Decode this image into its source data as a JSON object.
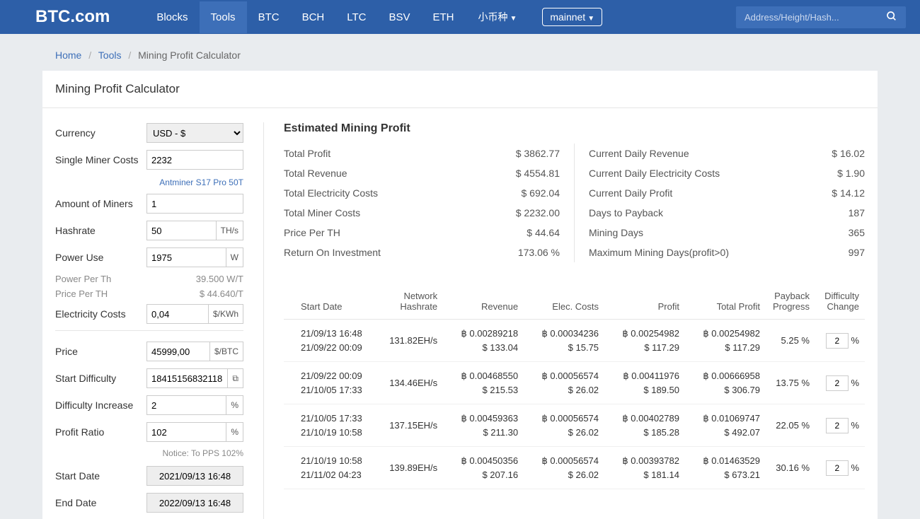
{
  "brand": "BTC.com",
  "nav": {
    "blocks": "Blocks",
    "tools": "Tools",
    "btc": "BTC",
    "bch": "BCH",
    "ltc": "LTC",
    "bsv": "BSV",
    "eth": "ETH",
    "small": "小币种",
    "net": "mainnet"
  },
  "search_placeholder": "Address/Height/Hash...",
  "breadcrumb": {
    "home": "Home",
    "tools": "Tools",
    "current": "Mining Profit Calculator"
  },
  "page_title": "Mining Profit Calculator",
  "form": {
    "currency_label": "Currency",
    "currency_value": "USD - $",
    "single_miner_label": "Single Miner Costs",
    "single_miner_value": "2232",
    "miner_model": "Antminer S17 Pro 50T",
    "amount_label": "Amount of Miners",
    "amount_value": "1",
    "hashrate_label": "Hashrate",
    "hashrate_value": "50",
    "hashrate_unit": "TH/s",
    "power_label": "Power Use",
    "power_value": "1975",
    "power_unit": "W",
    "power_per_th_label": "Power Per Th",
    "power_per_th_value": "39.500 W/T",
    "price_per_th_label": "Price Per TH",
    "price_per_th_value": "$ 44.640/T",
    "elec_label": "Electricity Costs",
    "elec_value": "0,04",
    "elec_unit": "$/KWh",
    "price_label": "Price",
    "price_value": "45999,00",
    "price_unit": "$/BTC",
    "start_diff_label": "Start Difficulty",
    "start_diff_value": "18415156832118",
    "diff_inc_label": "Difficulty Increase",
    "diff_inc_value": "2",
    "pct_unit": "%",
    "profit_ratio_label": "Profit Ratio",
    "profit_ratio_value": "102",
    "notice": "Notice: To PPS 102%",
    "start_date_label": "Start Date",
    "start_date_value": "2021/09/13 16:48",
    "end_date_label": "End Date",
    "end_date_value": "2022/09/13 16:48"
  },
  "estimated_title": "Estimated Mining Profit",
  "stats_left": {
    "total_profit_l": "Total Profit",
    "total_profit_v": "$ 3862.77",
    "total_revenue_l": "Total Revenue",
    "total_revenue_v": "$ 4554.81",
    "total_elec_l": "Total Electricity Costs",
    "total_elec_v": "$ 692.04",
    "total_miner_l": "Total Miner Costs",
    "total_miner_v": "$ 2232.00",
    "price_th_l": "Price Per TH",
    "price_th_v": "$ 44.64",
    "roi_l": "Return On Investment",
    "roi_v": "173.06 %"
  },
  "stats_right": {
    "daily_rev_l": "Current Daily Revenue",
    "daily_rev_v": "$ 16.02",
    "daily_elec_l": "Current Daily Electricity Costs",
    "daily_elec_v": "$ 1.90",
    "daily_profit_l": "Current Daily Profit",
    "daily_profit_v": "$ 14.12",
    "payback_l": "Days to Payback",
    "payback_v": "187",
    "mining_days_l": "Mining Days",
    "mining_days_v": "365",
    "max_days_l": "Maximum Mining Days(profit>0)",
    "max_days_v": "997"
  },
  "table_headers": {
    "start": "Start Date",
    "hashrate": "Network Hashrate",
    "revenue": "Revenue",
    "elec": "Elec. Costs",
    "profit": "Profit",
    "total_profit": "Total Profit",
    "payback": "Payback Progress",
    "diff": "Difficulty Change"
  },
  "rows": [
    {
      "d1": "21/09/13 16:48",
      "d2": "21/09/22 00:09",
      "hash": "131.82EH/s",
      "rev_b": "฿ 0.00289218",
      "rev_d": "$ 133.04",
      "elec_b": "฿ 0.00034236",
      "elec_d": "$ 15.75",
      "prof_b": "฿ 0.00254982",
      "prof_d": "$ 117.29",
      "tp_b": "฿ 0.00254982",
      "tp_d": "$ 117.29",
      "payback": "5.25 %",
      "diff": "2"
    },
    {
      "d1": "21/09/22 00:09",
      "d2": "21/10/05 17:33",
      "hash": "134.46EH/s",
      "rev_b": "฿ 0.00468550",
      "rev_d": "$ 215.53",
      "elec_b": "฿ 0.00056574",
      "elec_d": "$ 26.02",
      "prof_b": "฿ 0.00411976",
      "prof_d": "$ 189.50",
      "tp_b": "฿ 0.00666958",
      "tp_d": "$ 306.79",
      "payback": "13.75 %",
      "diff": "2"
    },
    {
      "d1": "21/10/05 17:33",
      "d2": "21/10/19 10:58",
      "hash": "137.15EH/s",
      "rev_b": "฿ 0.00459363",
      "rev_d": "$ 211.30",
      "elec_b": "฿ 0.00056574",
      "elec_d": "$ 26.02",
      "prof_b": "฿ 0.00402789",
      "prof_d": "$ 185.28",
      "tp_b": "฿ 0.01069747",
      "tp_d": "$ 492.07",
      "payback": "22.05 %",
      "diff": "2"
    },
    {
      "d1": "21/10/19 10:58",
      "d2": "21/11/02 04:23",
      "hash": "139.89EH/s",
      "rev_b": "฿ 0.00450356",
      "rev_d": "$ 207.16",
      "elec_b": "฿ 0.00056574",
      "elec_d": "$ 26.02",
      "prof_b": "฿ 0.00393782",
      "prof_d": "$ 181.14",
      "tp_b": "฿ 0.01463529",
      "tp_d": "$ 673.21",
      "payback": "30.16 %",
      "diff": "2"
    }
  ]
}
